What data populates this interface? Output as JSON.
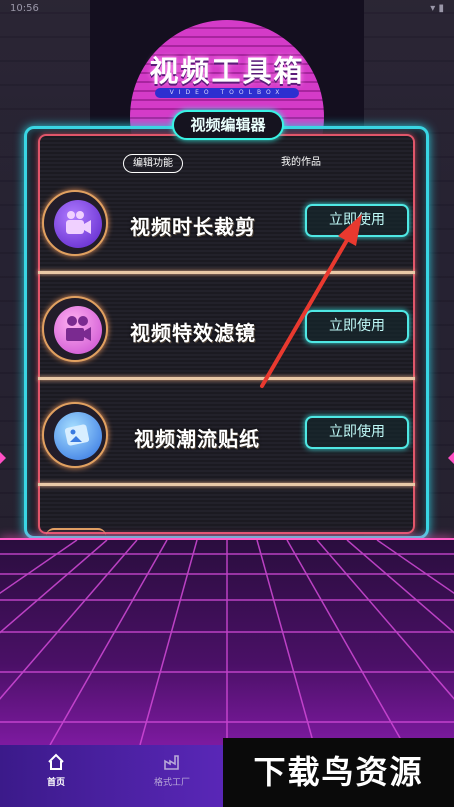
{
  "status_bar": {
    "time": "10:56"
  },
  "header": {
    "title": "视频工具箱",
    "subtitle": "VIDEO TOOLBOX",
    "section_title": "视频编辑器"
  },
  "tabs": [
    {
      "label": "编辑功能",
      "selected": true
    },
    {
      "label": "我的作品",
      "selected": false
    }
  ],
  "features": [
    {
      "name": "视频时长裁剪",
      "button": "立即使用",
      "icon": "video-camera-icon",
      "icon_color": "#7a3cf0"
    },
    {
      "name": "视频特效滤镜",
      "button": "立即使用",
      "icon": "film-camera-icon",
      "icon_color": "#d55ad8"
    },
    {
      "name": "视频潮流贴纸",
      "button": "立即使用",
      "icon": "image-sticker-icon",
      "icon_color": "#3a8cf0"
    }
  ],
  "bottom_nav": [
    {
      "label": "首页",
      "icon": "home-icon",
      "active": true
    },
    {
      "label": "格式工厂",
      "icon": "factory-icon",
      "active": false
    }
  ],
  "watermark": "下载鸟资源",
  "colors": {
    "cyan_neon": "#39f2e4",
    "pink_neon": "#e0566a",
    "sun": "#d43bc8",
    "arrow": "#e8392f"
  }
}
